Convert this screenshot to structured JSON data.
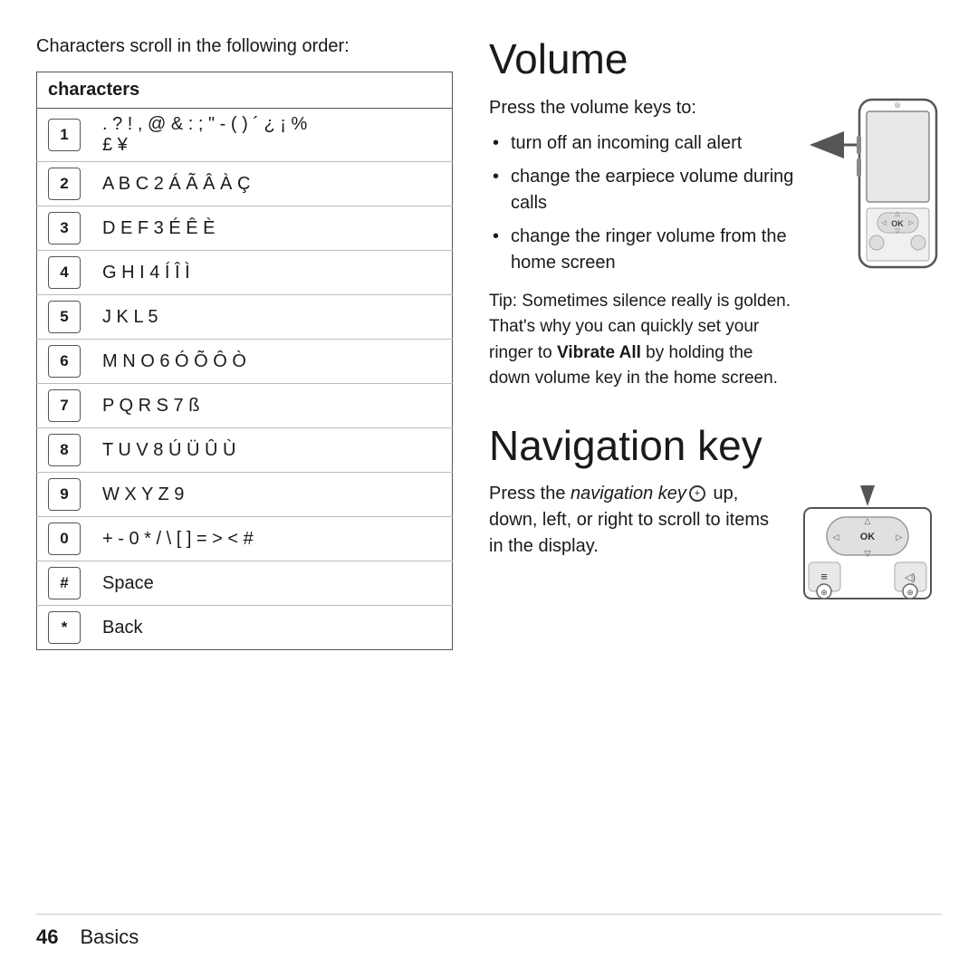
{
  "scroll_note": "Characters scroll in the following order:",
  "table": {
    "header": "characters",
    "rows": [
      {
        "key": "1",
        "chars": ". ? ! , @ & : ; \" - ( ) ´ ¿ ¡ %\n£ ¥"
      },
      {
        "key": "2",
        "chars": "A B C 2 Á Ã Â À Ç"
      },
      {
        "key": "3",
        "chars": "D E F 3 É Ê È"
      },
      {
        "key": "4",
        "chars": "G H I 4 Í Î Ì"
      },
      {
        "key": "5",
        "chars": "J K L 5"
      },
      {
        "key": "6",
        "chars": "M N O 6 Ó Õ Ô Ò"
      },
      {
        "key": "7",
        "chars": "P Q R S 7 ß"
      },
      {
        "key": "8",
        "chars": "T U V 8 Ú Ü Û Ù"
      },
      {
        "key": "9",
        "chars": "W X Y Z 9"
      },
      {
        "key": "0",
        "chars": "+ - 0 * / \\ [ ] = > < #"
      },
      {
        "key": "#",
        "chars": "Space"
      },
      {
        "key": "*",
        "chars": "Back"
      }
    ]
  },
  "volume": {
    "title": "Volume",
    "intro": "Press the volume keys to:",
    "bullets": [
      "turn off an incoming call alert",
      "change the earpiece volume during calls",
      "change the ringer volume from the home screen"
    ],
    "tip": "Tip: Sometimes silence really is golden. That's why you can quickly set your ringer to Vibrate All by holding the down volume key in the home screen."
  },
  "navigation": {
    "title": "Navigation key",
    "intro_prefix": "Press the",
    "intro_italic": "navigation key",
    "intro_suffix": "up, down, left, or right to scroll to items in the display."
  },
  "footer": {
    "page_number": "46",
    "section": "Basics"
  }
}
